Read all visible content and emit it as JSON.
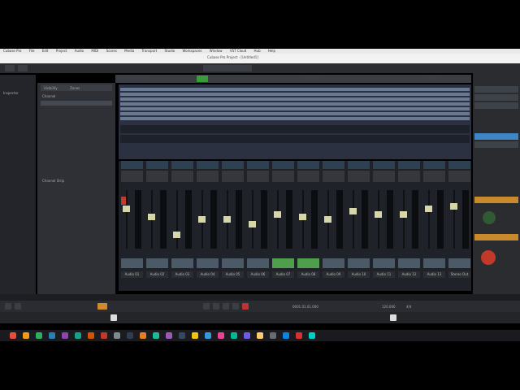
{
  "window": {
    "title": "Cubase Pro Project - [Untitled1]",
    "menu": [
      "Cubase Pro",
      "File",
      "Edit",
      "Project",
      "Audio",
      "MIDI",
      "Scores",
      "Media",
      "Transport",
      "Studio",
      "Workspaces",
      "Window",
      "VST Cloud",
      "Hub",
      "Help"
    ]
  },
  "inspector": {
    "tabs": [
      "Visibility",
      "Zones"
    ],
    "header_left": "Inspector",
    "list_title": "Channel",
    "section_label": "Channel Strip"
  },
  "mixer": {
    "channels": [
      {
        "name": "Audio 01",
        "fader": 0.7,
        "footer_on": false
      },
      {
        "name": "Audio 02",
        "fader": 0.55,
        "footer_on": false
      },
      {
        "name": "Audio 03",
        "fader": 0.2,
        "footer_on": false
      },
      {
        "name": "Audio 04",
        "fader": 0.5,
        "footer_on": false
      },
      {
        "name": "Audio 05",
        "fader": 0.5,
        "footer_on": false
      },
      {
        "name": "Audio 06",
        "fader": 0.4,
        "footer_on": false
      },
      {
        "name": "Audio 07",
        "fader": 0.6,
        "footer_on": true
      },
      {
        "name": "Audio 08",
        "fader": 0.55,
        "footer_on": true
      },
      {
        "name": "Audio 09",
        "fader": 0.5,
        "footer_on": false
      },
      {
        "name": "Audio 10",
        "fader": 0.65,
        "footer_on": false
      },
      {
        "name": "Audio 11",
        "fader": 0.6,
        "footer_on": false
      },
      {
        "name": "Audio 12",
        "fader": 0.6,
        "footer_on": false
      },
      {
        "name": "Audio 13",
        "fader": 0.7,
        "footer_on": false
      },
      {
        "name": "Stereo Out",
        "fader": 0.75,
        "footer_on": false
      }
    ]
  },
  "transport": {
    "position": "0001.01.01.000",
    "tempo": "120.000",
    "signature": "4/4"
  },
  "colors": {
    "accent": "#3f86c7",
    "fader_cap": "#d7d6a9",
    "active_green": "#4e9e4e",
    "red_button": "#c0392b"
  }
}
